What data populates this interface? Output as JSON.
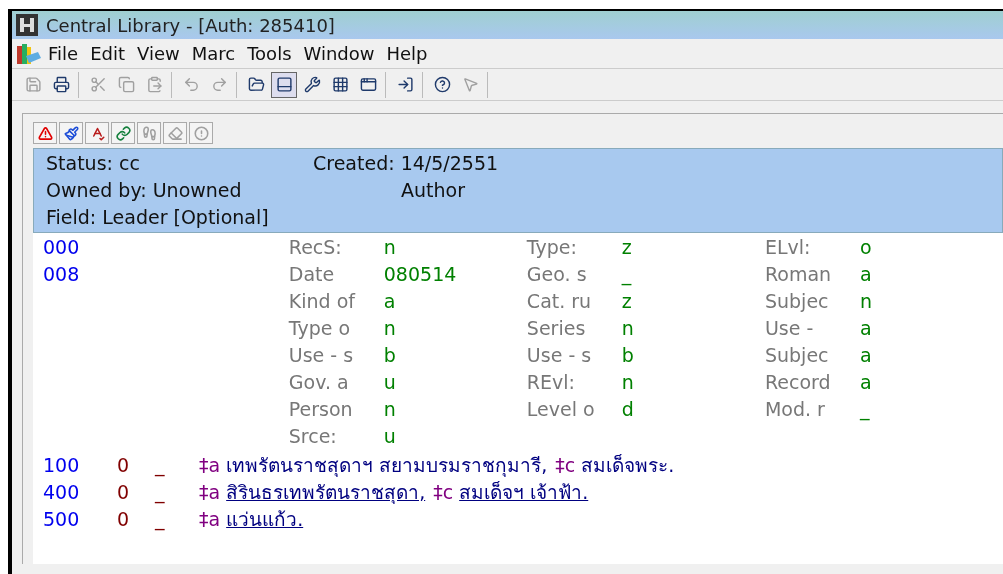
{
  "window": {
    "title": "Central Library - [Auth: 285410]"
  },
  "menu": [
    {
      "label": "File"
    },
    {
      "label": "Edit"
    },
    {
      "label": "View"
    },
    {
      "label": "Marc"
    },
    {
      "label": "Tools"
    },
    {
      "label": "Window"
    },
    {
      "label": "Help"
    }
  ],
  "toolbar": {
    "groups": [
      [
        {
          "disabled": true,
          "pressed": false
        },
        {
          "disabled": false,
          "pressed": false
        }
      ],
      [
        {
          "disabled": true,
          "pressed": false
        },
        {
          "disabled": true,
          "pressed": false
        },
        {
          "disabled": true,
          "pressed": false
        }
      ],
      [
        {
          "disabled": true,
          "pressed": false
        },
        {
          "disabled": true,
          "pressed": false
        }
      ],
      [
        {
          "disabled": false,
          "pressed": false
        },
        {
          "disabled": false,
          "pressed": true
        },
        {
          "disabled": false,
          "pressed": false
        },
        {
          "disabled": false,
          "pressed": false
        },
        {
          "disabled": false,
          "pressed": false
        }
      ],
      [
        {
          "disabled": false,
          "pressed": false
        }
      ],
      [
        {
          "disabled": false,
          "pressed": false
        },
        {
          "disabled": true,
          "pressed": false
        }
      ]
    ]
  },
  "record_toolbar": [
    {
      "disabled": false
    },
    {
      "disabled": false
    },
    {
      "disabled": false
    },
    {
      "disabled": false
    },
    {
      "disabled": true
    },
    {
      "disabled": true
    },
    {
      "disabled": true
    }
  ],
  "header": {
    "status": "Status: cc",
    "created": "Created: 14/5/2551",
    "owned_by": "Owned by: Unowned",
    "record_type": "Author",
    "field": "Field: Leader [Optional]"
  },
  "fixed_tags": [
    "000",
    "008"
  ],
  "fixed_fields": [
    [
      {
        "label": "RecS:",
        "value": "n"
      },
      {
        "label": "Date",
        "value": "080514"
      },
      {
        "label": "Kind of",
        "value": "a"
      },
      {
        "label": "Type o",
        "value": "n"
      },
      {
        "label": "Use - s",
        "value": "b"
      },
      {
        "label": "Gov. a",
        "value": "u"
      },
      {
        "label": "Person",
        "value": "n"
      },
      {
        "label": "Srce:",
        "value": "u"
      }
    ],
    [
      {
        "label": "Type:",
        "value": "z"
      },
      {
        "label": "Geo. s",
        "value": "_"
      },
      {
        "label": "Cat. ru",
        "value": "z"
      },
      {
        "label": "Series",
        "value": "n"
      },
      {
        "label": "Use - s",
        "value": "b"
      },
      {
        "label": "REvl:",
        "value": "n"
      },
      {
        "label": "Level o",
        "value": "d"
      }
    ],
    [
      {
        "label": "ELvl:",
        "value": "o"
      },
      {
        "label": "Roman",
        "value": "a"
      },
      {
        "label": "Subjec",
        "value": "n"
      },
      {
        "label": "Use -",
        "value": "a"
      },
      {
        "label": "Subjec",
        "value": "a"
      },
      {
        "label": "Record",
        "value": "a"
      },
      {
        "label": "Mod. r",
        "value": "_"
      }
    ]
  ],
  "fields": [
    {
      "tag": "100",
      "ind1": "0",
      "ind2": "_",
      "subfields": [
        {
          "code": "‡a",
          "text": "เทพรัตนราชสุดาฯ สยามบรมราชกุมารี,",
          "linked": false
        },
        {
          "code": "‡c",
          "text": "สมเด็จพระ.",
          "linked": false
        }
      ]
    },
    {
      "tag": "400",
      "ind1": "0",
      "ind2": "_",
      "subfields": [
        {
          "code": "‡a",
          "text": "สิรินธรเทพรัตนราชสุดา,",
          "linked": true
        },
        {
          "code": "‡c",
          "text": "สมเด็จฯ เจ้าฟ้า.",
          "linked": true
        }
      ]
    },
    {
      "tag": "500",
      "ind1": "0",
      "ind2": "_",
      "subfields": [
        {
          "code": "‡a",
          "text": "แว่นแก้ว.",
          "linked": true
        }
      ]
    }
  ]
}
